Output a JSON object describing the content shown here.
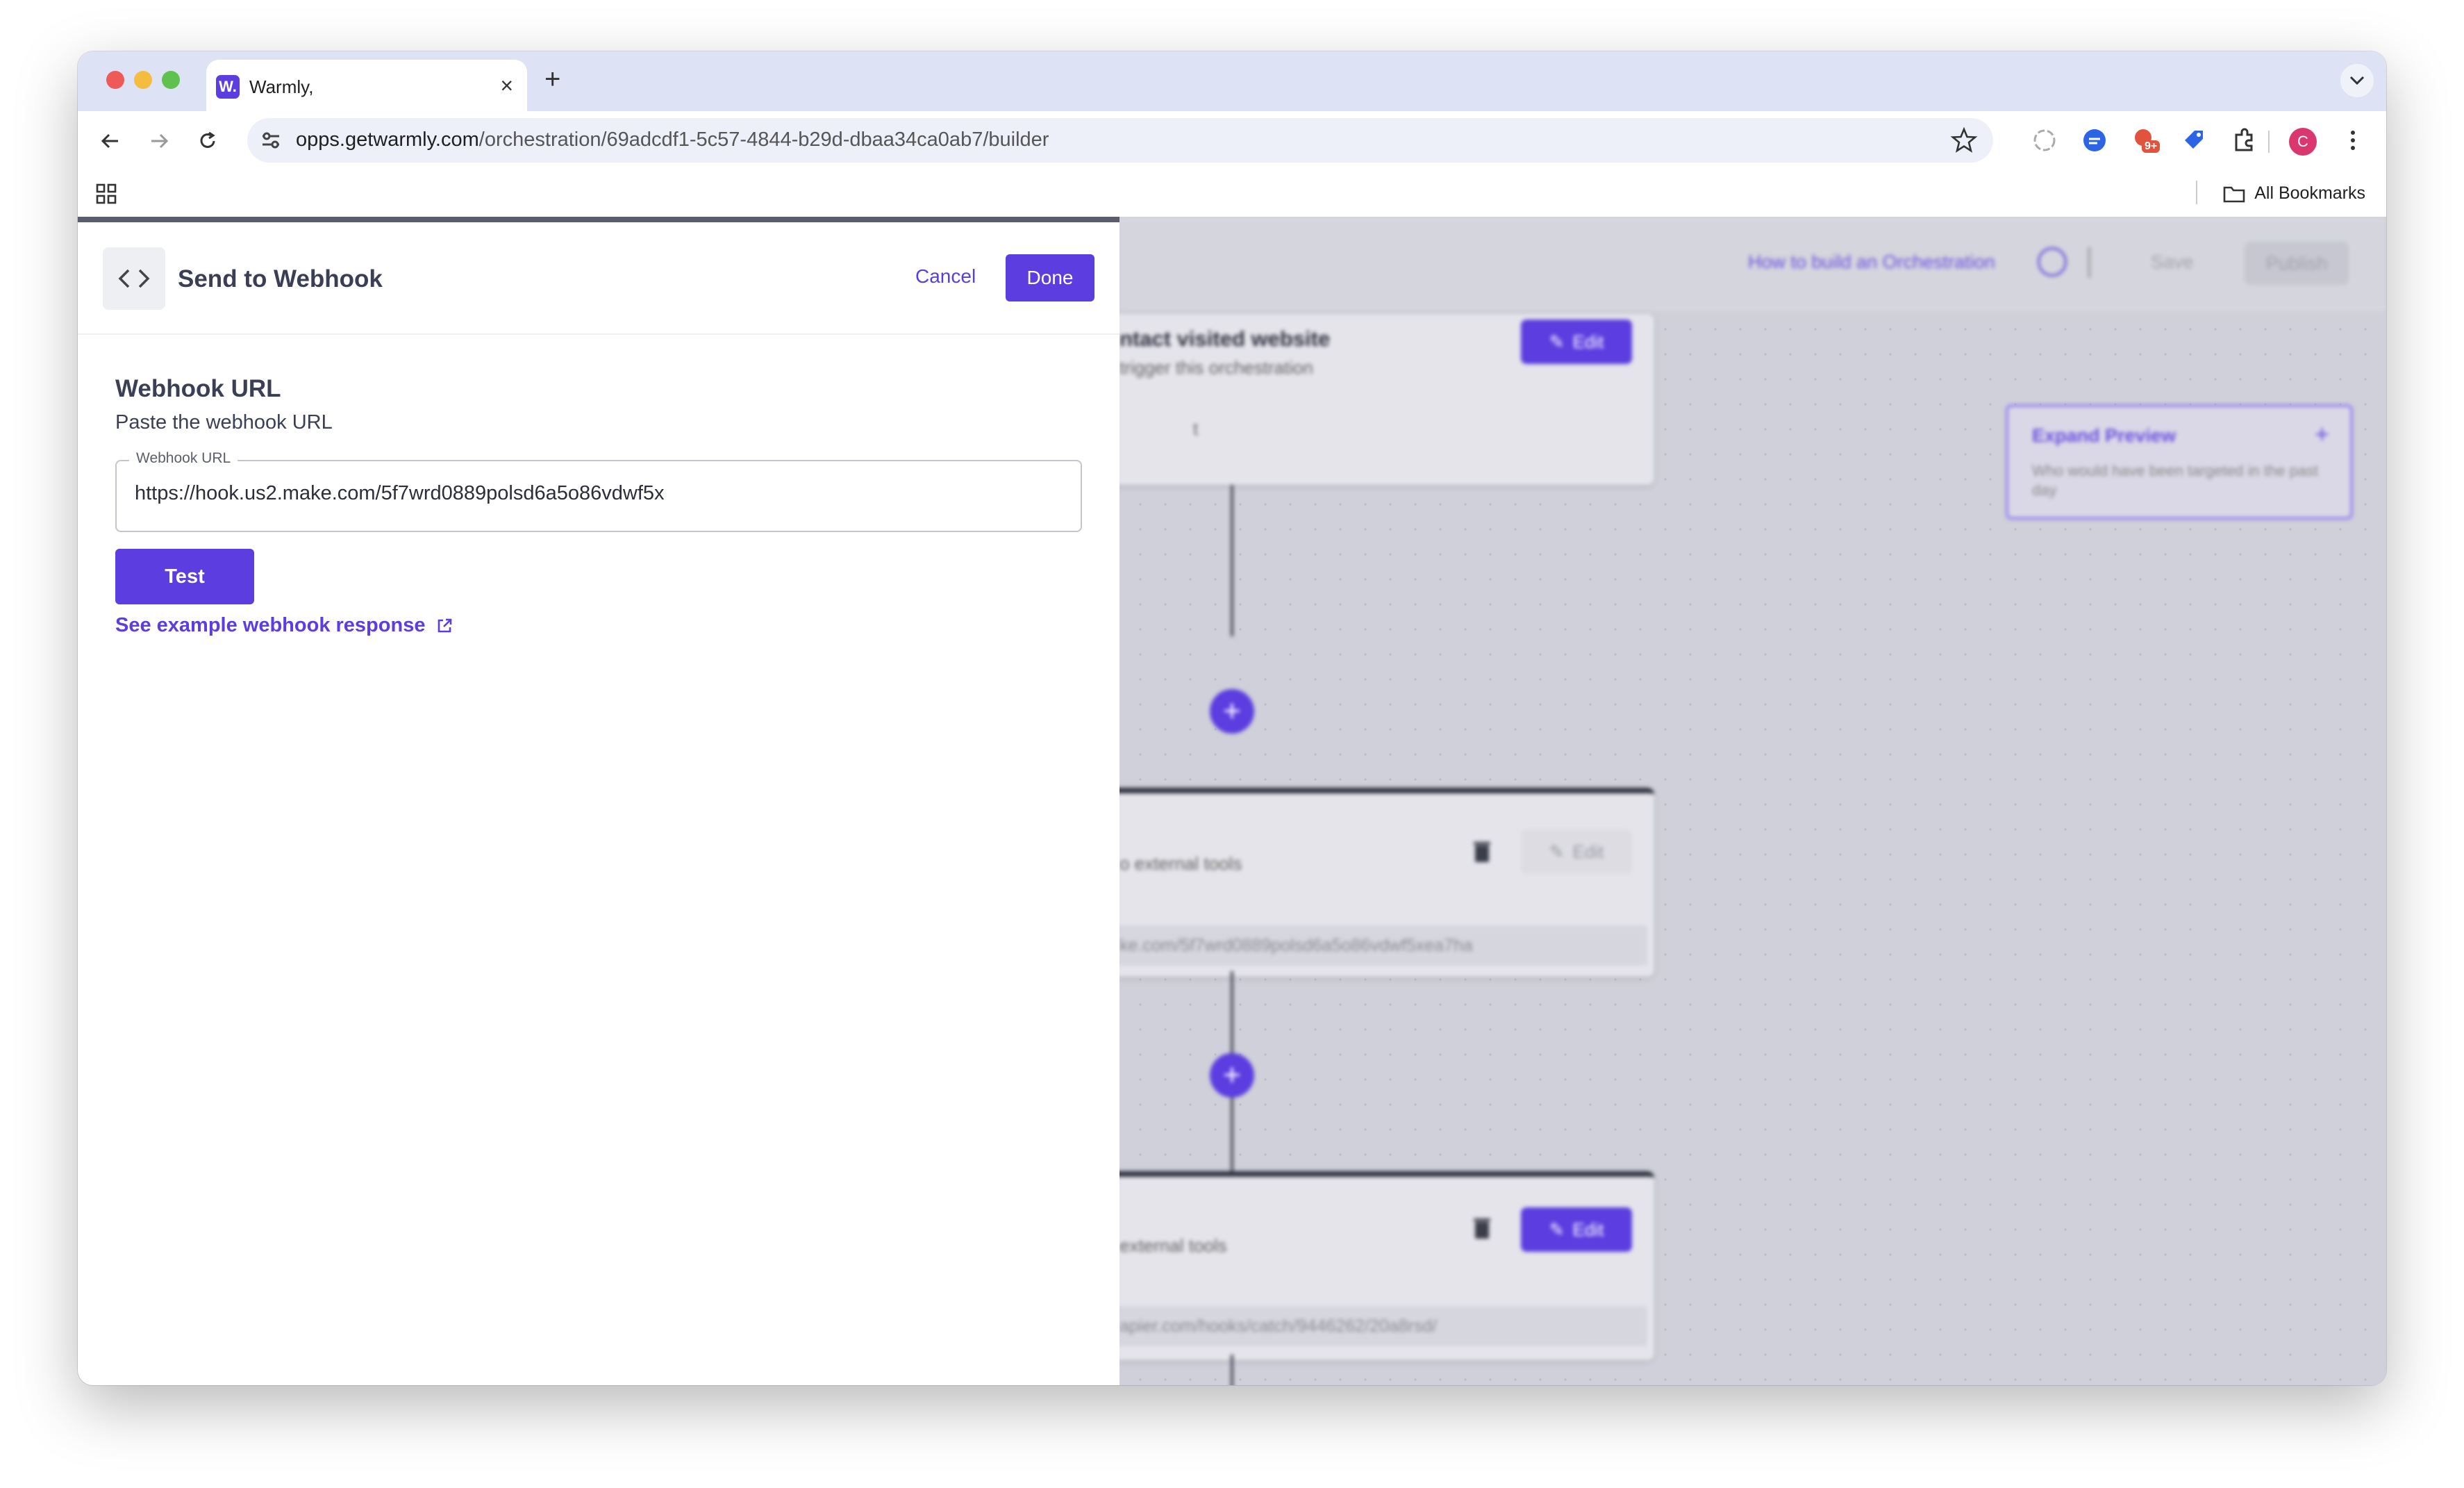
{
  "browser": {
    "tab": {
      "title": "Warmly,",
      "favicon_letter": "W."
    },
    "url": {
      "host": "opps.getwarmly.com",
      "path": "/orchestration/69adcdf1-5c57-4844-b29d-dbaa34ca0ab7/builder"
    },
    "bookmarks": {
      "all_label": "All Bookmarks"
    },
    "extensions": {
      "badge": "9+",
      "profile_letter": "C"
    },
    "icons": [
      "back-icon",
      "forward-icon",
      "reload-icon",
      "site-settings-icon",
      "star-icon",
      "extensions-icon",
      "menu-icon",
      "apps-icon",
      "folder-icon"
    ]
  },
  "builder": {
    "help_link": "How to build an Orchestration",
    "save_label": "Save",
    "publish_label": "Publish",
    "trigger_node": {
      "title": "ntact visited website",
      "subtitle": "trigger this orchestration",
      "detail": "t",
      "edit_label": "Edit"
    },
    "node2": {
      "text": "o external tools",
      "url": "ke.com/5f7wrd0889polsd6a5o86vdwf5xea7ha",
      "edit_label": "Edit"
    },
    "node3": {
      "text": "external tools",
      "url": "apier.com/hooks/catch/9446262/20a8rsd/",
      "edit_label": "Edit"
    },
    "preview": {
      "title": "Expand Preview",
      "text": "Who would have been targeted in the past day"
    },
    "accent": "#5b3de0"
  },
  "drawer": {
    "title": "Send to Webhook",
    "cancel_label": "Cancel",
    "done_label": "Done",
    "section_title": "Webhook URL",
    "section_subtitle": "Paste the webhook URL",
    "field": {
      "label": "Webhook URL",
      "value": "https://hook.us2.make.com/5f7wrd0889polsd6a5o86vdwf5x"
    },
    "test_label": "Test",
    "example_link": "See example webhook response"
  }
}
